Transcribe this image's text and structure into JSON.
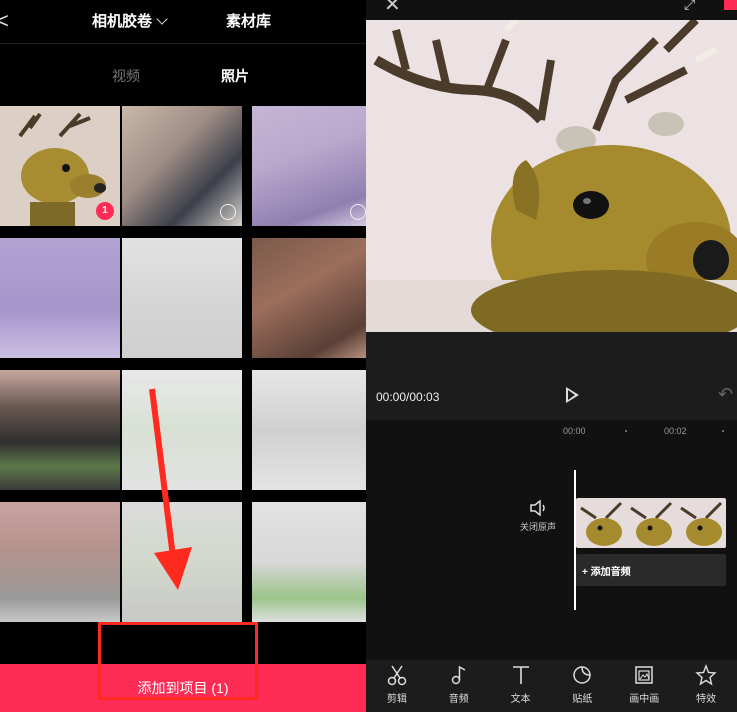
{
  "picker": {
    "album_title": "相机胶卷",
    "library_label": "素材库",
    "tabs": [
      "视频",
      "照片"
    ],
    "selected_count_badge": "1",
    "add_button_label": "添加到项目 (1)"
  },
  "editor": {
    "time_display": "00:00/00:03",
    "timeline_ticks": [
      "00:00",
      "00:02"
    ],
    "mute_label": "关闭原声",
    "add_audio_label": "+ 添加音频",
    "tools": [
      {
        "label": "剪辑",
        "icon": "scissors-icon"
      },
      {
        "label": "音频",
        "icon": "music-note-icon"
      },
      {
        "label": "文本",
        "icon": "text-icon"
      },
      {
        "label": "贴纸",
        "icon": "sticker-icon"
      },
      {
        "label": "画中画",
        "icon": "picture-in-picture-icon"
      },
      {
        "label": "特效",
        "icon": "effects-star-icon"
      }
    ]
  },
  "colors": {
    "accent": "#fe2c55",
    "annotation_red": "#ff2a1f",
    "editor_bg": "#1c1c1c"
  }
}
